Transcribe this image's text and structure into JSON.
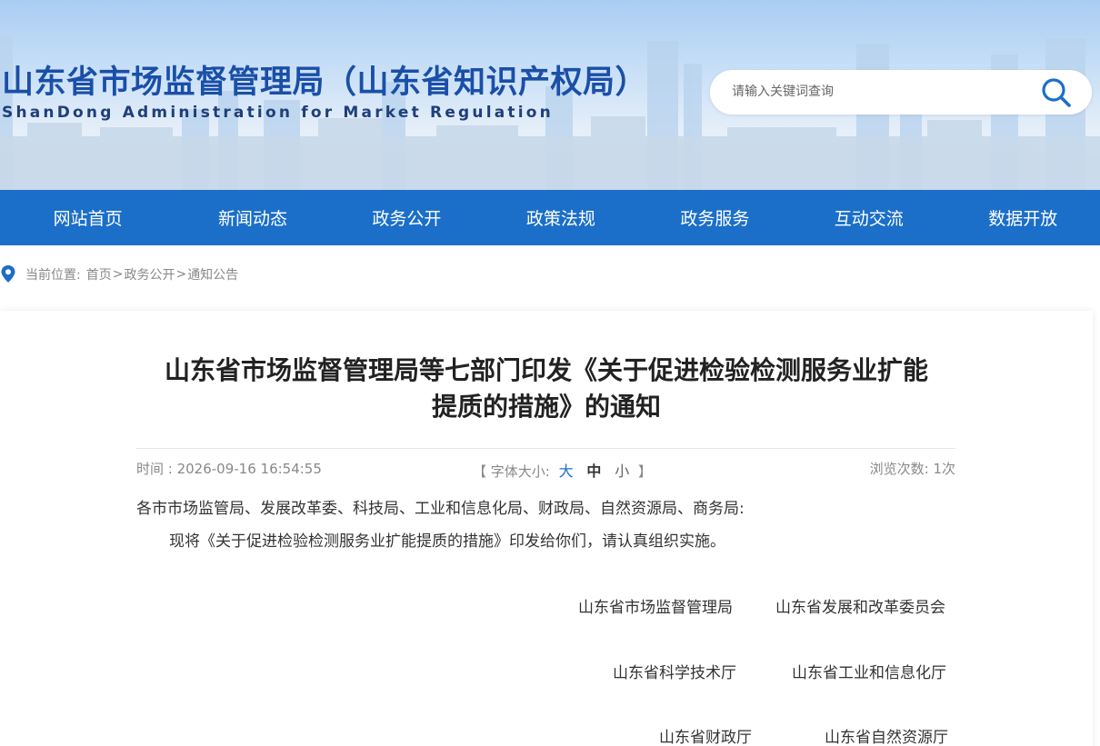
{
  "header": {
    "title": "山东省市场监督管理局（山东省知识产权局）",
    "subtitle": "ShanDong Administration for Market Regulation",
    "search_placeholder": "请输入关键词查询",
    "search_icon": "search-icon"
  },
  "nav": {
    "items": [
      {
        "label": "网站首页"
      },
      {
        "label": "新闻动态"
      },
      {
        "label": "政务公开"
      },
      {
        "label": "政策法规"
      },
      {
        "label": "政务服务"
      },
      {
        "label": "互动交流"
      },
      {
        "label": "数据开放"
      }
    ]
  },
  "breadcrumb": {
    "prefix": "当前位置:",
    "items": [
      "首页",
      "政务公开",
      "通知公告"
    ],
    "separator": ">"
  },
  "article": {
    "title_line1": "山东省市场监督管理局等七部门印发《关于促进检验检测服务业扩能",
    "title_line2": "提质的措施》的通知",
    "time": "时间 : 2026-09-16 16:54:55",
    "font_size_label": "【 字体大小:",
    "font_size_close": "】",
    "font_large": "大",
    "font_medium": "中",
    "font_small": "小",
    "views": "浏览次数:  1次",
    "salutation": "各市市场监管局、发展改革委、科技局、工业和信息化局、财政局、自然资源局、商务局:",
    "paragraph": "现将《关于促进检验检测服务业扩能提质的措施》印发给你们，请认真组织实施。",
    "signatures": [
      [
        "山东省市场监督管理局",
        "山东省发展和改革委员会"
      ],
      [
        "山东省科学技术厅",
        "山东省工业和信息化厅"
      ],
      [
        "山东省财政厅",
        "山东省自然资源厅"
      ]
    ]
  },
  "colors": {
    "nav_bg": "#1b6fc8",
    "title_blue": "#1a4fa8",
    "accent": "#1b6fc8"
  }
}
